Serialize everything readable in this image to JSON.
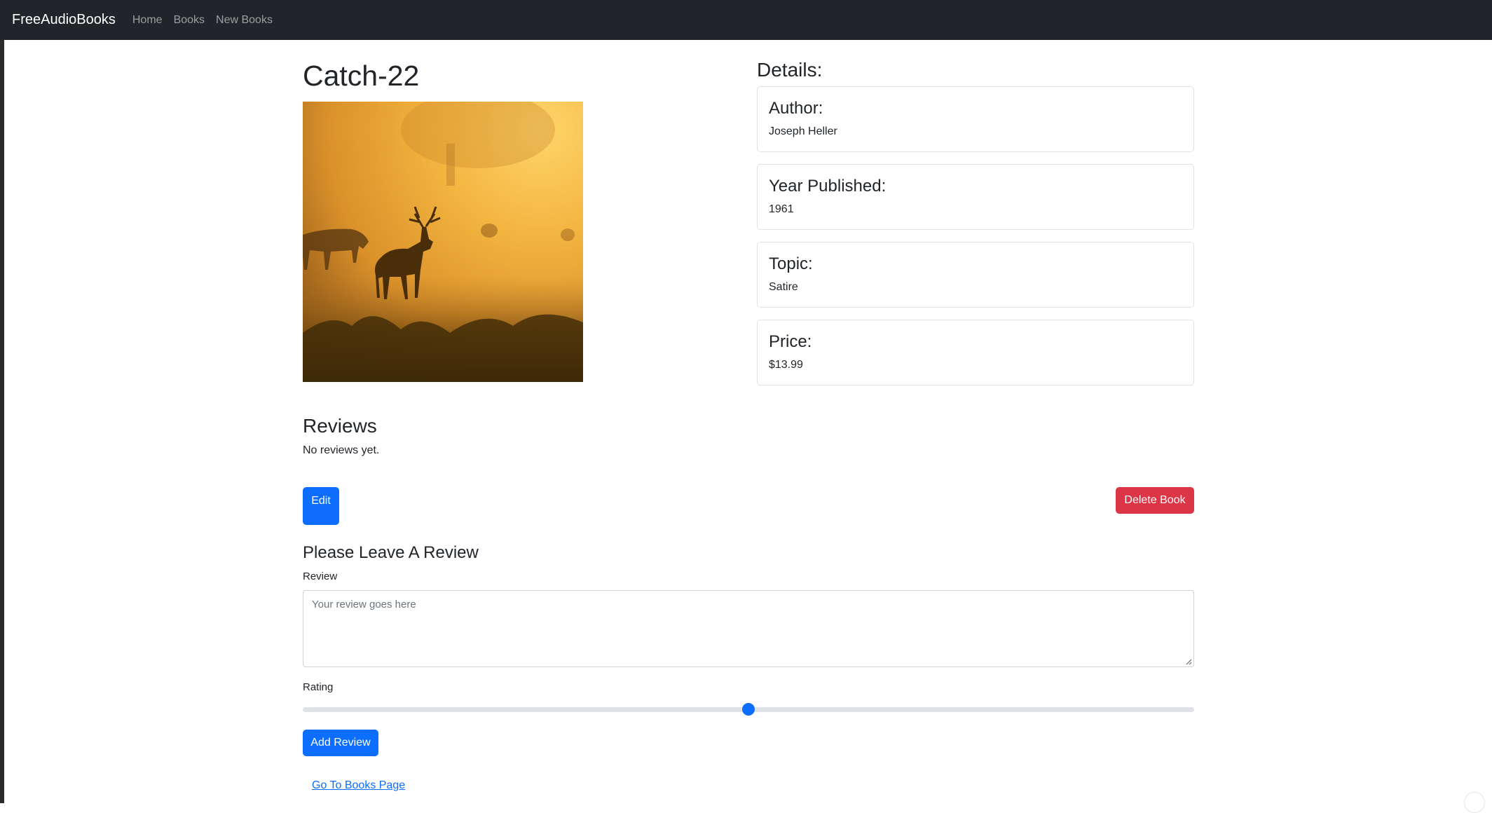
{
  "navbar": {
    "brand": "FreeAudioBooks",
    "links": [
      "Home",
      "Books",
      "New Books"
    ]
  },
  "book": {
    "title": "Catch-22",
    "cover_alt": "deer silhouettes in golden misty sunrise"
  },
  "details": {
    "heading": "Details:",
    "cards": [
      {
        "label": "Author:",
        "value": "Joseph Heller"
      },
      {
        "label": "Year Published:",
        "value": "1961"
      },
      {
        "label": "Topic:",
        "value": "Satire"
      },
      {
        "label": "Price:",
        "value": "$13.99"
      }
    ]
  },
  "reviews": {
    "heading": "Reviews",
    "empty_text": "No reviews yet."
  },
  "actions": {
    "edit_label": "Edit",
    "delete_label": "Delete Book"
  },
  "review_form": {
    "heading": "Please Leave A Review",
    "review_label": "Review",
    "review_placeholder": "Your review goes here",
    "rating_label": "Rating",
    "rating_value_fraction": 0.5,
    "submit_label": "Add Review"
  },
  "footer_link": "Go To Books Page",
  "colors": {
    "navbar": "#212529",
    "primary": "#0d6efd",
    "danger": "#dc3545"
  }
}
